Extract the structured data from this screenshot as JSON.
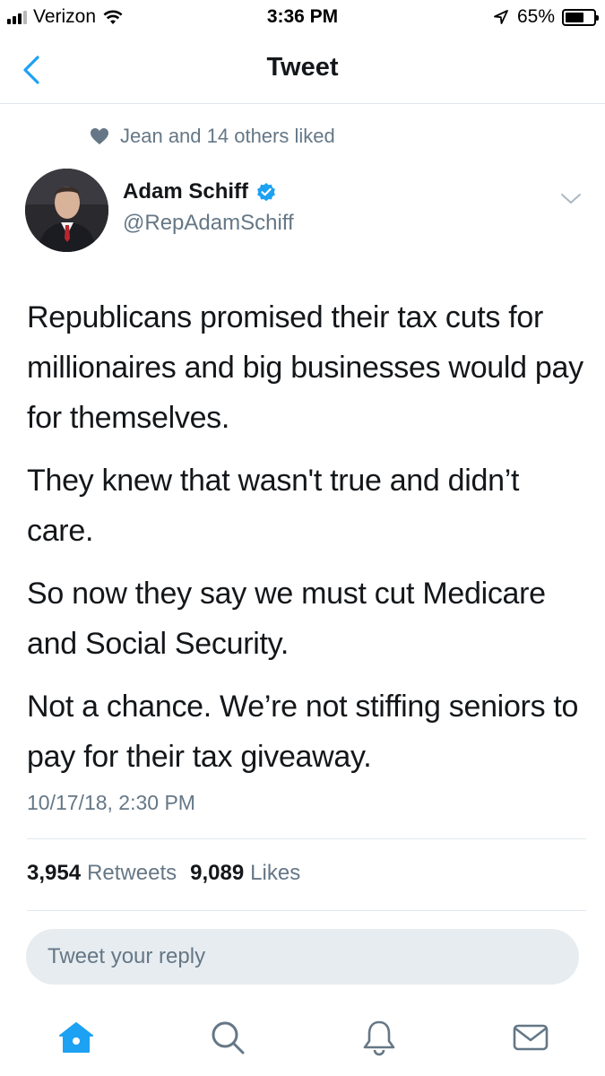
{
  "status_bar": {
    "carrier": "Verizon",
    "time": "3:36 PM",
    "battery": "65%",
    "battery_level": 0.65,
    "icons": [
      "signal-icon",
      "wifi-icon",
      "location-arrow-icon",
      "battery-icon"
    ]
  },
  "nav": {
    "title": "Tweet",
    "back_icon": "chevron-left-icon"
  },
  "social_context": {
    "icon": "heart-icon",
    "text": "Jean and 14 others liked"
  },
  "tweet": {
    "author_name": "Adam Schiff",
    "handle": "@RepAdamSchiff",
    "verified": true,
    "paragraphs": [
      "Republicans promised their tax cuts for millionaires and big businesses would pay for themselves.",
      "They knew that wasn't true and didn’t care.",
      "So now they say we must cut Medicare and Social Security.",
      "Not a chance. We’re not stiffing seniors to pay for their tax giveaway."
    ],
    "timestamp": "10/17/18, 2:30 PM",
    "retweets_count": "3,954",
    "retweets_label": "Retweets",
    "likes_count": "9,089",
    "likes_label": "Likes"
  },
  "reply": {
    "placeholder": "Tweet your reply"
  },
  "tab_bar": {
    "items": [
      "home-icon",
      "search-icon",
      "notifications-bell-icon",
      "messages-envelope-icon"
    ],
    "active_color": "#1da1f2",
    "inactive_color": "#657786"
  },
  "colors": {
    "brand_blue": "#1da1f2",
    "secondary_text": "#657786",
    "divider": "#e1e8ed"
  }
}
